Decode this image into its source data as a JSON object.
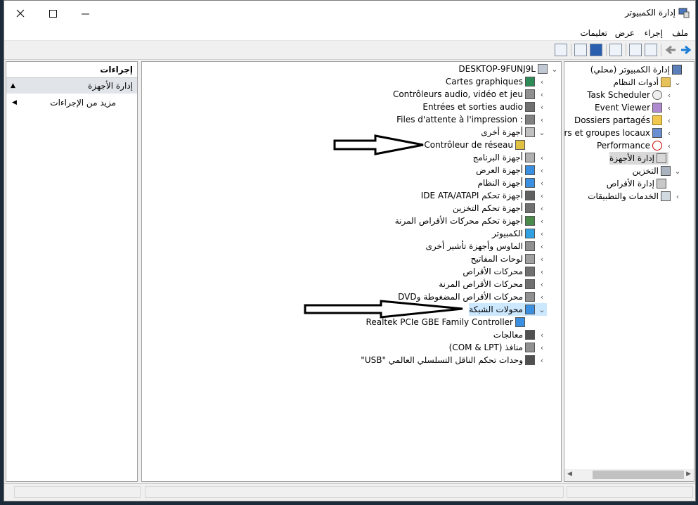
{
  "window": {
    "title": "إدارة الكمبيوتر"
  },
  "menu": {
    "file": "ملف",
    "action": "إجراء",
    "view": "عرض",
    "help": "تعليمات"
  },
  "left_tree": {
    "root": "إدارة الكمبيوتر (محلي)",
    "system_tools": "أدوات النظام",
    "task_scheduler": "Task Scheduler",
    "event_viewer": "Event Viewer",
    "shared_folders": "Dossiers partagés",
    "local_users": "Utilisateurs et groupes locaux",
    "performance": "Performance",
    "device_manager": "إدارة الأجهزة",
    "storage": "التخزين",
    "disk_management": "إدارة الأقراص",
    "services_apps": "الخدمات والتطبيقات"
  },
  "device_tree": {
    "computer": "DESKTOP-9FUNJ9L",
    "items": [
      "Cartes graphiques",
      "Contrôleurs audio, vidéo et jeu",
      "Entrées et sorties audio",
      "Files d'attente à l'impression :",
      "أجهزة أخرى",
      "Contrôleur de réseau",
      "أجهزة البرنامج",
      "أجهزة العرض",
      "أجهزة النظام",
      "أجهزة تحكم IDE ATA/ATAPI",
      "أجهزة تحكم التخزين",
      "أجهزة تحكم محركات الأقراص المرنة",
      "الكمبيوتر",
      "الماوس وأجهزة تأشير أخرى",
      "لوحات المفاتيح",
      "محركات الأقراص",
      "محركات الأقراص المرنة",
      "محركات الأقراص المضغوطة وDVD",
      "محولات الشبكة",
      "Realtek PCIe GBE Family Controller",
      "معالجات",
      "منافذ (COM & LPT)",
      "وحدات تحكم الناقل التسلسلي العالمي \"USB\""
    ]
  },
  "actions": {
    "header": "إجراءات",
    "device_manager": "إدارة الأجهزة",
    "more_actions": "مزيد من الإجراءات"
  }
}
